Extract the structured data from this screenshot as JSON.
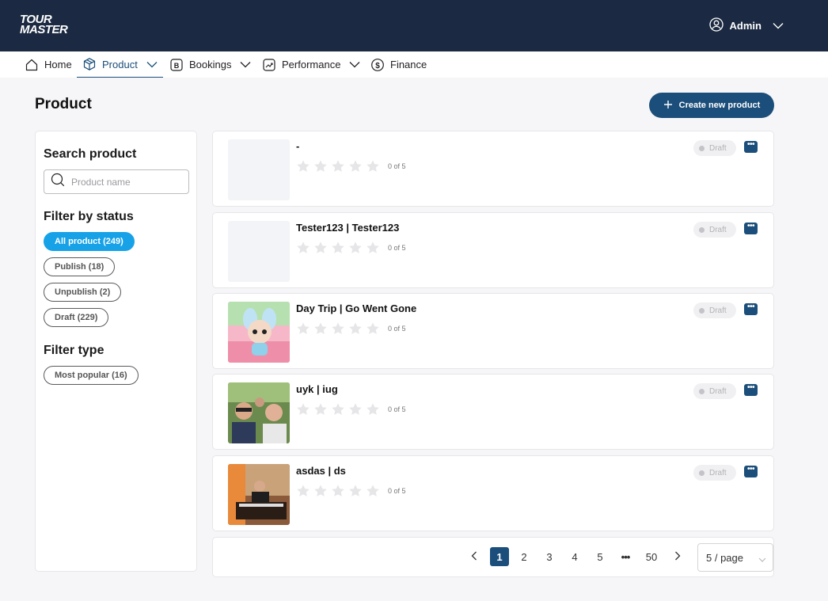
{
  "brand": {
    "line1": "TOUR",
    "line2": "MASTER"
  },
  "user": {
    "name": "Admin"
  },
  "nav": [
    {
      "label": "Home",
      "icon": "home-icon"
    },
    {
      "label": "Product",
      "icon": "box-icon",
      "dropdown": true,
      "active": true
    },
    {
      "label": "Bookings",
      "icon": "bookings-icon",
      "dropdown": true
    },
    {
      "label": "Performance",
      "icon": "chart-icon",
      "dropdown": true
    },
    {
      "label": "Finance",
      "icon": "finance-icon"
    }
  ],
  "page": {
    "title": "Product",
    "create_label": "Create new product"
  },
  "sidebar": {
    "search_heading": "Search product",
    "search_placeholder": "Product name",
    "status_heading": "Filter by status",
    "status_filters": [
      "All product (249)",
      "Publish (18)",
      "Unpublish (2)",
      "Draft (229)"
    ],
    "type_heading": "Filter type",
    "type_filters": [
      "Most popular (16)"
    ]
  },
  "products": [
    {
      "title": "-",
      "rating": "0 of 5",
      "status": "Draft",
      "image": "placeholder"
    },
    {
      "title": "Tester123 | Tester123",
      "rating": "0 of 5",
      "status": "Draft",
      "image": "placeholder"
    },
    {
      "title": "Day Trip | Go Went Gone",
      "rating": "0 of 5",
      "status": "Draft",
      "image": "toy-photo"
    },
    {
      "title": "uyk | iug",
      "rating": "0 of 5",
      "status": "Draft",
      "image": "people-photo"
    },
    {
      "title": "asdas | ds",
      "rating": "0 of 5",
      "status": "Draft",
      "image": "piano-photo"
    }
  ],
  "pagination": {
    "pages": [
      "1",
      "2",
      "3",
      "4",
      "5",
      "•••",
      "50"
    ],
    "current": "1",
    "page_size": "5 / page"
  },
  "colors": {
    "header": "#1b2a42",
    "primary": "#1b4e7a",
    "active_chip": "#17a2e8"
  }
}
